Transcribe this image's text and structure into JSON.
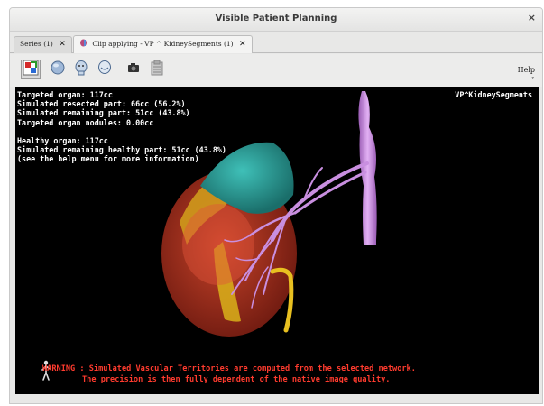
{
  "window": {
    "title": "Visible Patient Planning",
    "close": "×"
  },
  "tabs": [
    {
      "label": "Series (1)",
      "close": "✕"
    },
    {
      "label": "Clip applying - VP ^ KidneySegments (1)",
      "close": "✕"
    }
  ],
  "toolbar": {
    "tools": [
      "clip-tool-icon",
      "sphere-icon",
      "head-icon",
      "head-outline-icon",
      "camera-icon",
      "clipboard-icon"
    ],
    "help": "Help",
    "help_caret": "▾"
  },
  "viewer": {
    "scene_label": "VP^KidneySegments",
    "info": {
      "line1": "Targeted organ: 117cc",
      "line2": "Simulated resected part: 66cc (56.2%)",
      "line3": "Simulated remaining part: 51cc (43.8%)",
      "line4": "Targeted organ nodules: 0.00cc",
      "line5": "Healthy organ: 117cc",
      "line6": "Simulated remaining healthy part: 51cc (43.8%)",
      "line7": "(see the help menu for more information)"
    },
    "warning": {
      "line1": "WARNING : Simulated Vascular Territories are computed from the selected network.",
      "line2": "The precision is then fully dependent of the native image quality."
    },
    "colors": {
      "teal": "#2fa39e",
      "red": "#b8321e",
      "yellow": "#d9b21a",
      "orange": "#c46a1e",
      "vessel": "#c98fe0",
      "warning": "#ff3b2e"
    }
  }
}
